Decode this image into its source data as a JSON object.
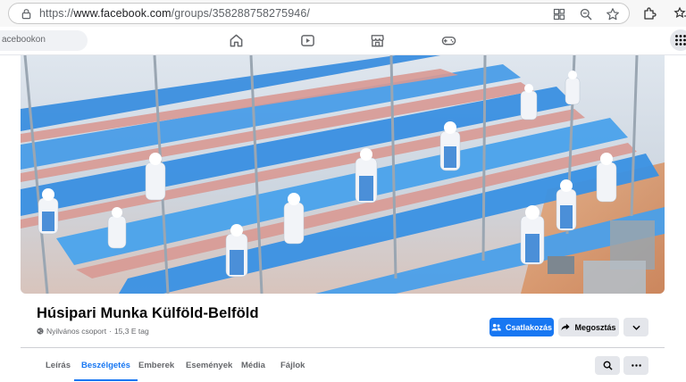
{
  "browser": {
    "url_prefix": "https://",
    "url_domain": "www.facebook.com",
    "url_path": "/groups/358288758275946/"
  },
  "fb_nav": {
    "search_text": "acebookon"
  },
  "group": {
    "title": "Húsipari Munka Külföld-Belföld",
    "privacy": "Nyilvános csoport",
    "separator": "·",
    "members": "15,3 E tag"
  },
  "actions": {
    "join_label": "Csatlakozás",
    "share_label": "Megosztás"
  },
  "tabs": [
    {
      "label": "Leírás"
    },
    {
      "label": "Beszélgetés"
    },
    {
      "label": "Emberek"
    },
    {
      "label": "Események"
    },
    {
      "label": "Média"
    },
    {
      "label": "Fájlok"
    }
  ],
  "active_tab": "Beszélgetés",
  "colors": {
    "accent": "#1877f2",
    "button_gray": "#e4e6eb",
    "text_secondary": "#65676b"
  }
}
